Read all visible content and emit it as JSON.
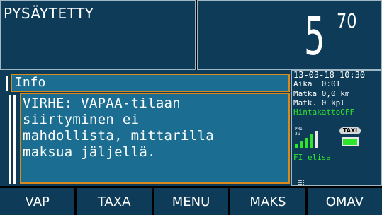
{
  "status": {
    "text": "PYSÄYTETTY"
  },
  "price": {
    "main": "5",
    "cents": "70"
  },
  "dialog": {
    "title": "Info",
    "message_lines": [
      "VIRHE: VAPAA-tilaan",
      "siirtyminen ei",
      "mahdollista, mittarilla",
      "maksua jäljellä."
    ]
  },
  "side": {
    "datetime": "13-03-18 10:30",
    "aika": "Aika  0:01",
    "matka": "Matka 0,0 km",
    "matk": "Matk. 0 kpl",
    "hintakatto": "HintakattoOFF",
    "pri_label": "PRI",
    "sec_label": "2G",
    "taxi_label": "TAXI",
    "network": "FI elisa"
  },
  "footer": {
    "buttons": [
      "VAP",
      "TAXA",
      "MENU",
      "MAKS",
      "OMAV"
    ]
  },
  "colors": {
    "panel": "#0e3c58",
    "highlight": "#1b6e91",
    "border": "#d98a1a",
    "green": "#2ee52e"
  }
}
